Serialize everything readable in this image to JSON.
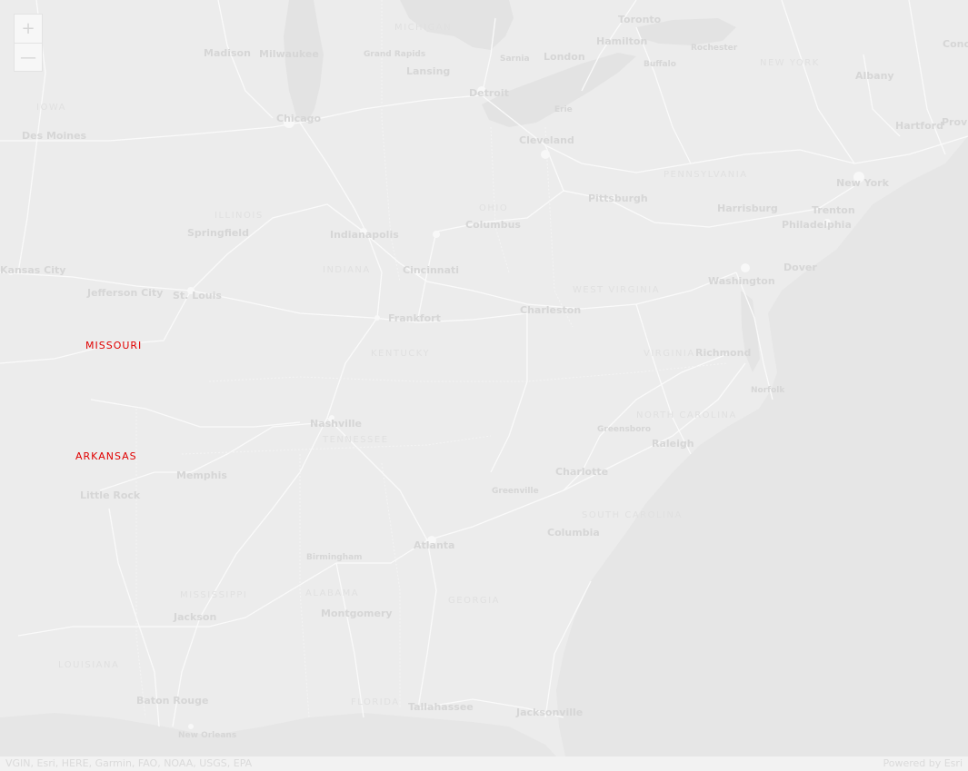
{
  "zoom_controls": {
    "zoom_in": "+",
    "zoom_out": "—"
  },
  "attribution": {
    "sources": "VGIN, Esri, HERE, Garmin, FAO, NOAA, USGS, EPA",
    "powered_by": "Powered by Esri"
  },
  "highlighted_labels": [
    {
      "id": "missouri",
      "text": "MISSOURI",
      "color": "#e00000"
    },
    {
      "id": "arkansas",
      "text": "ARKANSAS",
      "color": "#e00000"
    }
  ],
  "city_labels": [
    "Toronto",
    "Hamilton",
    "London",
    "Rochester",
    "Buffalo",
    "Albany",
    "Concord",
    "Madison",
    "Milwaukee",
    "Grand Rapids",
    "Lansing",
    "Detroit",
    "Chicago",
    "Des Moines",
    "Cleveland",
    "Hartford",
    "Providence",
    "New York",
    "Trenton",
    "Pittsburgh",
    "Harrisburg",
    "Philadelphia",
    "Columbus",
    "Springfield",
    "Indianapolis",
    "Kansas City",
    "Cincinnati",
    "Dover",
    "Jefferson City",
    "St. Louis",
    "Washington",
    "Charleston",
    "Frankfort",
    "Richmond",
    "Norfolk",
    "Nashville",
    "Greensboro",
    "Raleigh",
    "Memphis",
    "Charlotte",
    "Little Rock",
    "Greenville",
    "Columbia",
    "Atlanta",
    "Birmingham",
    "Jackson",
    "Montgomery",
    "Baton Rouge",
    "Tallahassee",
    "Jacksonville",
    "New Orleans",
    "Sarnia",
    "Erie"
  ],
  "state_labels": [
    "MICHIGAN",
    "NEW YORK",
    "OHIO",
    "PENNSYLVANIA",
    "WEST VIRGINIA",
    "KENTUCKY",
    "VIRGINIA",
    "TENNESSEE",
    "NORTH CAROLINA",
    "SOUTH CAROLINA",
    "MISSISSIPPI",
    "ALABAMA",
    "GEORGIA",
    "LOUISIANA",
    "FLORIDA",
    "ILLINOIS",
    "INDIANA",
    "IOWA"
  ],
  "colors": {
    "land": "#ececec",
    "water": "#e4e4e4",
    "roads": "#fafafa",
    "label": "#d3d3d3",
    "highlight": "#e00000"
  }
}
